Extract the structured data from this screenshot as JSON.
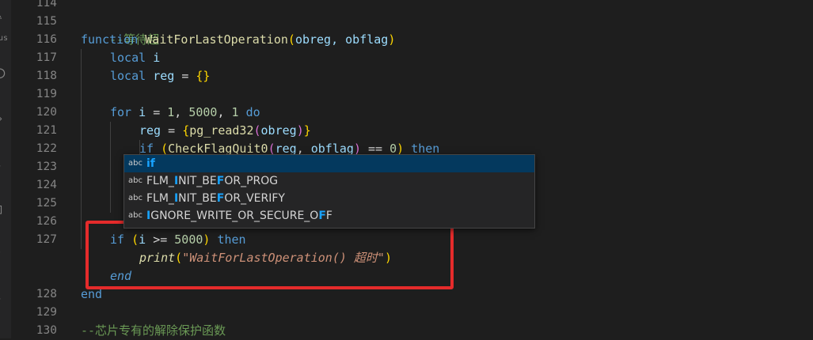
{
  "activity_icons": [
    "files-icon",
    "search-icon",
    "source-control-icon",
    "debug-icon",
    "extensions-icon",
    "remote-icon",
    "ellipsis-icon"
  ],
  "activity_partial_text": "us",
  "line_numbers": [
    "114",
    "115",
    "116",
    "117",
    "118",
    "119",
    "120",
    "121",
    "122",
    "123",
    "124",
    "125",
    "126",
    "127",
    "",
    "",
    "128",
    "129",
    "130"
  ],
  "code": {
    "l115": "--等待超",
    "l116_kw": "function",
    "l116_fn": "WaitForLastOperation",
    "l116_params": "obreg, obflag",
    "l117_kw": "local",
    "l117_var": "i",
    "l118_kw": "local",
    "l118_var": "reg",
    "l118_rest": "{}",
    "l120_kw": "for",
    "l120_var": "i",
    "l120_n1": "1",
    "l120_n2": "5000",
    "l120_n3": "1",
    "l120_do": "do",
    "l121_var": "reg",
    "l121_fn": "pg_read32",
    "l121_arg": "obreg",
    "l122_if": "if",
    "l122_fn": "CheckFlagQuit0",
    "l122_a1": "reg",
    "l122_a2": "obflag",
    "l122_num": "0",
    "l122_then": "then",
    "l127_if": "if",
    "l127_var": "i",
    "l127_num": "5000",
    "l127_then": "then",
    "l127b_fn": "print",
    "l127b_str": "\"WaitForLastOperation() 超时\"",
    "l127c_end": "end",
    "l128_end": "end",
    "l130": "--芯片专有的解除保护函数"
  },
  "suggest": {
    "icon_text": "abc",
    "items": [
      {
        "pre": "",
        "hl": "if",
        "post": "",
        "selected": true
      },
      {
        "parts": [
          "FLM_",
          "I",
          "NIT_BE",
          "F",
          "OR_PROG"
        ]
      },
      {
        "parts": [
          "FLM_",
          "I",
          "NIT_BE",
          "F",
          "OR_VERIFY"
        ]
      },
      {
        "parts": [
          "",
          "I",
          "GNORE_WRITE_OR_SECURE_O",
          "F",
          "F"
        ]
      }
    ]
  },
  "annotation_color": "#e52b2b"
}
